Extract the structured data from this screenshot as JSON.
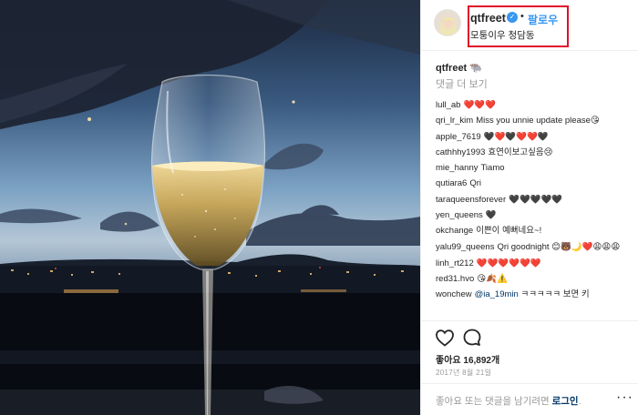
{
  "post": {
    "username": "qtfreet",
    "verified_icon": "verified-badge-icon",
    "follow_label": "팔로우",
    "separator": "•",
    "location": "모퉁이우 청담동"
  },
  "caption": {
    "username": "qtfreet",
    "emoji": "🐃"
  },
  "more_comments_label": "댓글 더 보기",
  "comments": [
    {
      "user": "lull_ab",
      "text": "❤️❤️❤️"
    },
    {
      "user": "qri_lr_kim",
      "text": "Miss you unnie update please😘"
    },
    {
      "user": "apple_7619",
      "text": "🖤❤️🖤❤️❤️🖤"
    },
    {
      "user": "cathhhy1993",
      "text": "효연이보고싶음😢"
    },
    {
      "user": "mie_hanny",
      "text": "Tiamo"
    },
    {
      "user": "qutiara6",
      "text": "Qri"
    },
    {
      "user": "taraqueensforever",
      "text": "🖤🖤🖤🖤🖤"
    },
    {
      "user": "yen_queens",
      "text": "🖤"
    },
    {
      "user": "okchange",
      "text": "이쁜이 예뻐네요~!"
    },
    {
      "user": "yalu99_queens",
      "text": "Qri goodnight 😊🐻🌙❤️😩😩😩"
    },
    {
      "user": "linh_rt212",
      "text": "❤️❤️❤️❤️❤️❤️"
    },
    {
      "user": "red31.hvo",
      "text": "😘🍂⚠️"
    },
    {
      "user": "wonchew",
      "mention": "@ia_19min",
      "text": "ㅋㅋㅋㅋㅋ 보면 키"
    }
  ],
  "actions": {
    "like_icon": "heart-icon",
    "comment_icon": "comment-bubble-icon",
    "likes_label": "좋아요 16,892개",
    "date": "2017년 8월 21일"
  },
  "login_bar": {
    "prompt": "좋아요 또는 댓글을 남기려면",
    "link": "로그인",
    "period": ".",
    "menu_icon": "more-dots-icon",
    "menu_label": "···"
  },
  "colors": {
    "accent": "#3897f0",
    "highlight_box": "#e0102b",
    "link": "#003569",
    "muted": "#999999"
  }
}
